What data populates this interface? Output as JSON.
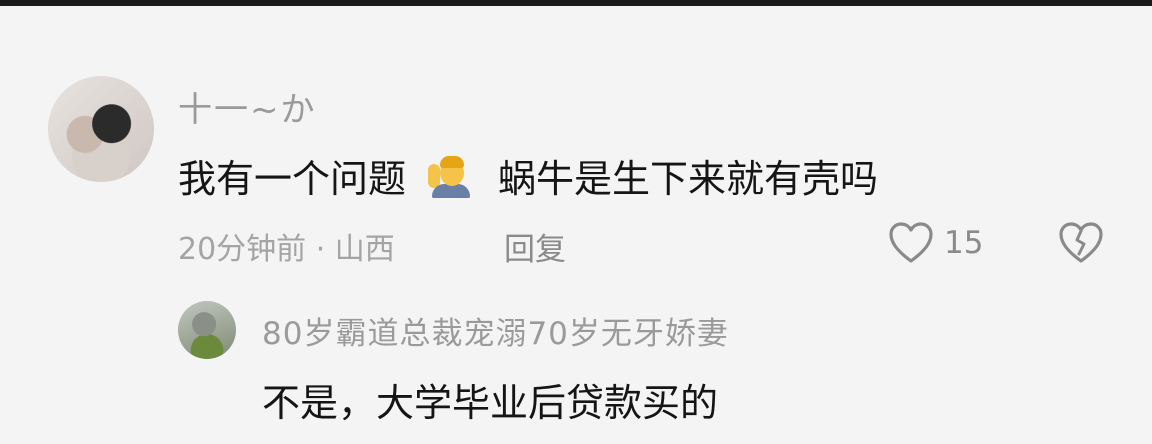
{
  "comment": {
    "username": "十一~か",
    "text_before_emoji": "我有一个问题",
    "emoji_name": "person-raising-hand-emoji",
    "text_after_emoji": "蜗牛是生下来就有壳吗",
    "meta": "20分钟前 · 山西",
    "reply_label": "回复",
    "like_count": "15",
    "like_icon": "heart-outline-icon",
    "dislike_icon": "broken-heart-icon"
  },
  "reply": {
    "username": "80岁霸道总裁宠溺70岁无牙娇妻",
    "text": "不是，大学毕业后贷款买的"
  }
}
